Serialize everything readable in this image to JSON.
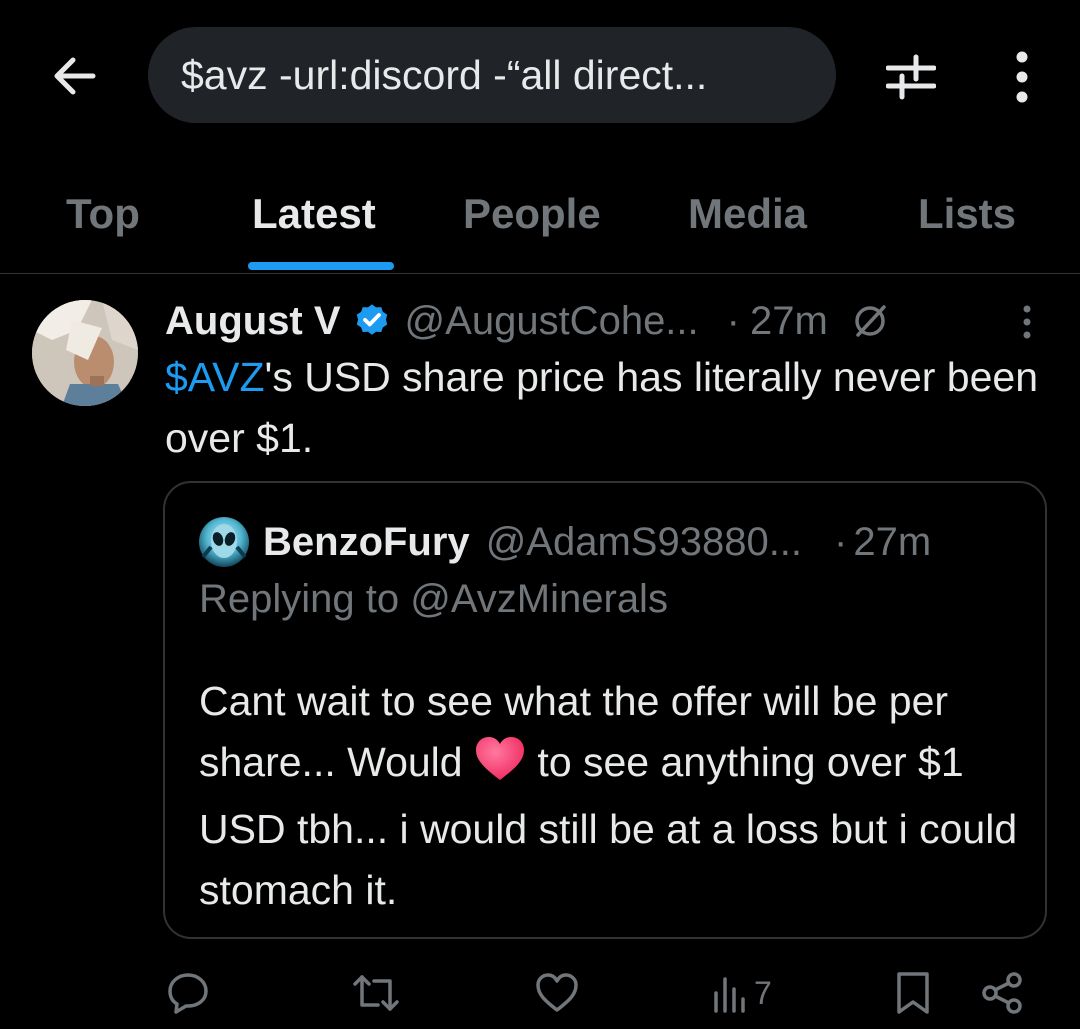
{
  "search": {
    "query": "$avz -url:discord -“all direct..."
  },
  "tabs": [
    {
      "label": "Top"
    },
    {
      "label": "Latest"
    },
    {
      "label": "People"
    },
    {
      "label": "Media"
    },
    {
      "label": "Lists"
    }
  ],
  "tweet": {
    "author_name": "August V",
    "handle": "@AugustCohe...",
    "separator": "·",
    "time": "27m",
    "cashtag": "$AVZ",
    "text_rest": "'s USD share price has literally never been over $1.",
    "quote": {
      "author_name": "BenzoFury",
      "handle": "@AdamS93880...",
      "separator": "·",
      "time": "27m",
      "replying_to": "Replying to @AvzMinerals",
      "text_part1": "Cant wait to see what the offer will be per share... Would",
      "text_part2": "to see anything over $1 USD tbh... i would still be at a loss but i could stomach it."
    },
    "views_count": "7"
  },
  "colors": {
    "accent": "#1d9bf0",
    "muted": "#71767b",
    "text": "#e7e9ea",
    "background": "#000000",
    "heart_emoji": "#ff3d6e"
  }
}
